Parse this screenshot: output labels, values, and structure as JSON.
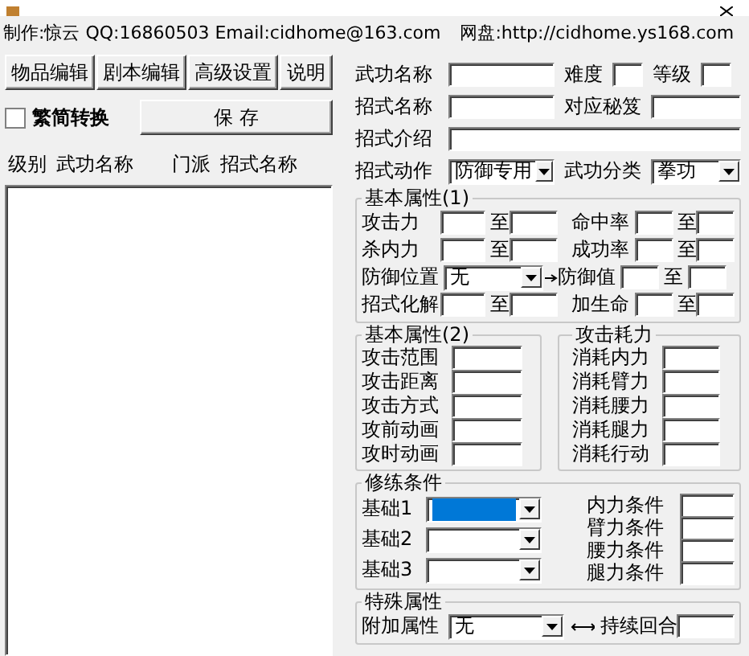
{
  "credits": [
    "制作:惊云 QQ:16860503 Email:cidhome@163.com",
    "网盘:http://cidhome.ys168.com"
  ],
  "toolbar_buttons": [
    "物品编辑",
    "剧本编辑",
    "高级设置",
    "说明"
  ],
  "convert_checkbox": {
    "label": "繁简转换",
    "checked": false
  },
  "save_button": "保 存",
  "list": {
    "columns": [
      "级别",
      "武功名称",
      "门派",
      "招式名称"
    ]
  },
  "top_rows": [
    [
      {
        "label": "武功名称",
        "kind": "text"
      },
      {
        "label": "难度",
        "kind": "short"
      },
      {
        "label": "等级",
        "kind": "short"
      }
    ],
    [
      {
        "label": "招式名称",
        "kind": "text"
      },
      {
        "label": "对应秘笈",
        "kind": "text"
      }
    ],
    [
      {
        "label": "招式介绍",
        "kind": "wide"
      }
    ],
    [
      {
        "label": "招式动作",
        "kind": "select",
        "value": "防御专用"
      },
      {
        "label": "武功分类",
        "kind": "select",
        "value": "拳功"
      }
    ]
  ],
  "basic_attributes_1": {
    "title": "基本属性(1)",
    "rows": [
      [
        {
          "label": "攻击力",
          "kind": "range",
          "to": "至"
        },
        {
          "label": "命中率",
          "kind": "range",
          "to": "至"
        }
      ],
      [
        {
          "label": "杀内力",
          "kind": "range",
          "to": "至"
        },
        {
          "label": "成功率",
          "kind": "range",
          "to": "至"
        }
      ],
      [
        {
          "label": "防御位置",
          "kind": "select",
          "value": "无"
        },
        {
          "label": "防御值",
          "kind": "linked_range",
          "to": "至"
        }
      ],
      [
        {
          "label": "招式化解",
          "kind": "range",
          "to": "至"
        },
        {
          "label": "加生命",
          "kind": "range",
          "to": "至"
        }
      ]
    ]
  },
  "basic_attributes_2": {
    "title": "基本属性(2)",
    "fields": [
      "攻击范围",
      "攻击距离",
      "攻击方式",
      "攻前动画",
      "攻时动画"
    ]
  },
  "attack_cost": {
    "title": "攻击耗力",
    "fields": [
      "消耗内力",
      "消耗臂力",
      "消耗腰力",
      "消耗腿力",
      "消耗行动"
    ]
  },
  "training": {
    "title": "修练条件",
    "bases": [
      {
        "label": "基础1",
        "selected": true
      },
      {
        "label": "基础2",
        "selected": false
      },
      {
        "label": "基础3",
        "selected": false
      }
    ],
    "conditions": [
      "内力条件",
      "臂力条件",
      "腰力条件",
      "腿力条件"
    ]
  },
  "special": {
    "title": "特殊属性",
    "label": "附加属性",
    "value": "无",
    "duration_label": "持续回合"
  }
}
